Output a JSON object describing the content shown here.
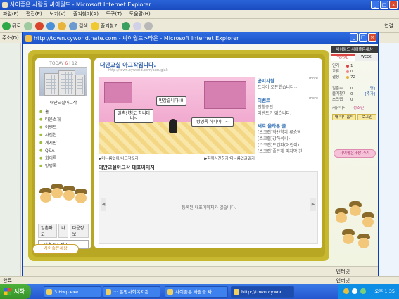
{
  "outer_window": {
    "title": "사이좋은 사람들 싸이월드 - Microsoft Internet Explorer",
    "menu": [
      "파일(F)",
      "편집(E)",
      "보기(V)",
      "즐겨찾기(A)",
      "도구(T)",
      "도움말(H)"
    ],
    "toolbar": {
      "back": "뒤로",
      "search": "검색",
      "favorites": "즐겨찾기"
    },
    "address_label": "주소(D)",
    "links_label": "연결",
    "status_left": "완료",
    "status_zone": "인터넷"
  },
  "popup": {
    "title": "http://town.cyworld.nate.com - 싸이월드>타운 - Microsoft Internet Explorer",
    "status_zone": "인터넷"
  },
  "left_panel": {
    "today_label": "TODAY",
    "today_count": "6",
    "total_count": "12",
    "title": "대안교실아그작",
    "menu": [
      "홈",
      "타운소개",
      "이벤트",
      "사진첩",
      "게시판",
      "Q&A",
      "회의록",
      "방명록"
    ],
    "ilchon_tab": "일촌파도",
    "ilchon_tabs": [
      "나",
      "타운정보"
    ],
    "ilchon_select": "★일촌 파도타기"
  },
  "main": {
    "title": "대안교실 아그작입니다.",
    "url": "http://town.cyworld.com/aurugjak",
    "bubbles": [
      "반갑습니다!!!",
      "일촌신청도 하니미니~",
      "방명록 하니미니~"
    ],
    "room_link_left": "▶미니룸없어/나그작꼬리",
    "room_link_right": "▶함께사진하기/미니룸업글일기",
    "notice_heading": "공지사항",
    "notice_text": "드디어 오픈했습니다~",
    "event_heading": "이벤트",
    "event_text1": "진행중인",
    "event_text2": "이벤트가 없습니다.",
    "new_posts_heading": "새로 올라온 글",
    "new_posts": [
      "[스크랩]학산향과 류승범",
      "[스크랩]강하욱씨~",
      "[스크랩]트캡파(어린이)",
      "[스크랩]좋은해 파자막 친"
    ],
    "more": "more",
    "rep_title": "대안교실아그작 대표이미지",
    "rep_empty": "등록된 대표이미지가 없습니다."
  },
  "bottom_logo": "사이좋은세상",
  "right_panel": {
    "header": "싸이월드 사이좋은세상",
    "tabs": [
      "TOTAL",
      "WEEK"
    ],
    "stats": [
      {
        "label": "인기",
        "value": "1"
      },
      {
        "label": "교류",
        "value": "0"
      },
      {
        "label": "결정",
        "value": "72"
      }
    ],
    "counts": [
      {
        "label": "일촌수",
        "value": "0",
        "link": "[명]"
      },
      {
        "label": "즐겨찾기",
        "value": "0",
        "link": "[추가]"
      },
      {
        "label": "스크랩",
        "value": "0"
      }
    ],
    "keeper_label": "커뮤니티",
    "keeper_name": "정소닌",
    "btn_mine": "내 미니홈피",
    "btn_login": "로그인",
    "pink_btn": "사이좋은세상 가기",
    "accent": "#d44a3a"
  },
  "taskbar": {
    "start": "시작",
    "tasks": [
      "3 Hwp.exe",
      "::: 은평사회복지관 ...",
      "사이좋은 사람들 싸...",
      "http://town.cywor..."
    ],
    "clock": "오후 1:35"
  }
}
